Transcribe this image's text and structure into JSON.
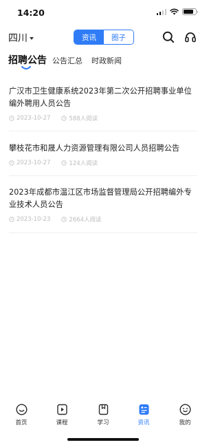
{
  "status_bar": {
    "time": "14:20"
  },
  "header": {
    "region": "四川",
    "segments": [
      {
        "label": "资讯",
        "active": true
      },
      {
        "label": "圈子",
        "active": false
      }
    ],
    "accent_color": "#2f7cf6"
  },
  "tabs": [
    {
      "label": "招聘公告",
      "active": true
    },
    {
      "label": "公告汇总",
      "active": false
    },
    {
      "label": "时政新闻",
      "active": false
    }
  ],
  "articles": [
    {
      "title": "广汉市卫生健康系统2023年第二次公开招聘事业单位编外聘用人员公告",
      "date": "2023-10-27",
      "views": "588人阅读"
    },
    {
      "title": "攀枝花市和晟人力资源管理有限公司人员招聘公告",
      "date": "2023-10-27",
      "views": "124人阅读"
    },
    {
      "title": "2023年成都市温江区市场监督管理局公开招聘编外专业技术人员公告",
      "date": "2023-10-23",
      "views": "2664人阅读"
    }
  ],
  "bottom_nav": [
    {
      "label": "首页",
      "icon": "home-face-icon",
      "active": false
    },
    {
      "label": "课程",
      "icon": "play-course-icon",
      "active": false
    },
    {
      "label": "学习",
      "icon": "book-icon",
      "active": false
    },
    {
      "label": "资讯",
      "icon": "news-icon",
      "active": true
    },
    {
      "label": "我的",
      "icon": "profile-face-icon",
      "active": false
    }
  ]
}
